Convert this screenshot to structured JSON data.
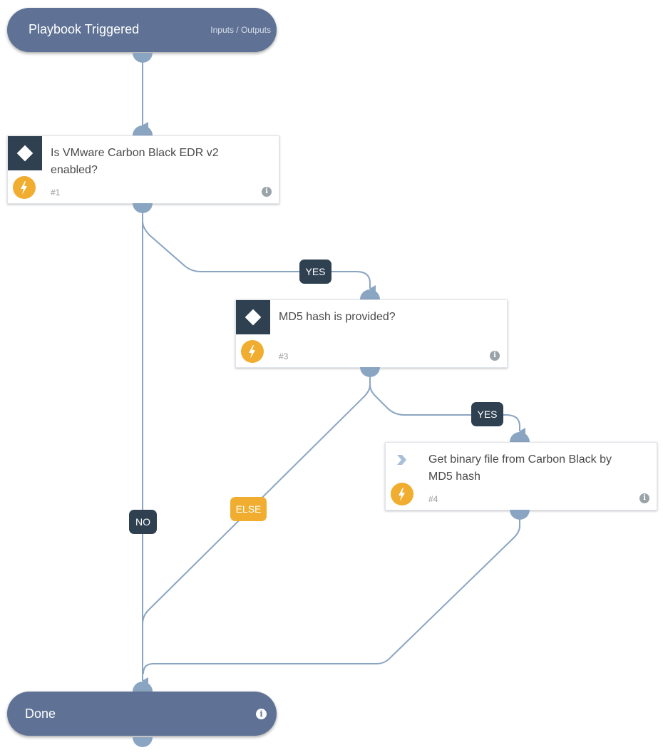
{
  "start": {
    "title": "Playbook Triggered",
    "io_link": "Inputs / Outputs"
  },
  "end": {
    "title": "Done",
    "info_icon": "info-icon"
  },
  "tasks": [
    {
      "id": "1",
      "name": "Is VMware Carbon Black EDR v2 enabled?",
      "number": "#1",
      "type": "condition",
      "icon": "diamond-icon"
    },
    {
      "id": "3",
      "name": "MD5 hash is provided?",
      "number": "#3",
      "type": "condition",
      "icon": "diamond-icon"
    },
    {
      "id": "4",
      "name": "Get binary file from Carbon Black by MD5 hash",
      "number": "#4",
      "type": "playbook",
      "icon": "chevron-right-icon"
    }
  ],
  "edge_labels": {
    "task1_yes": "YES",
    "task1_no": "NO",
    "task3_yes": "YES",
    "task3_else": "ELSE"
  },
  "colors": {
    "node_pill": "#5f7296",
    "condition_header": "#2f4050",
    "automation_badge": "#f0ad30",
    "edge": "#8aa5c2",
    "label_dark": "#2f4050",
    "label_else": "#f0ad30"
  }
}
